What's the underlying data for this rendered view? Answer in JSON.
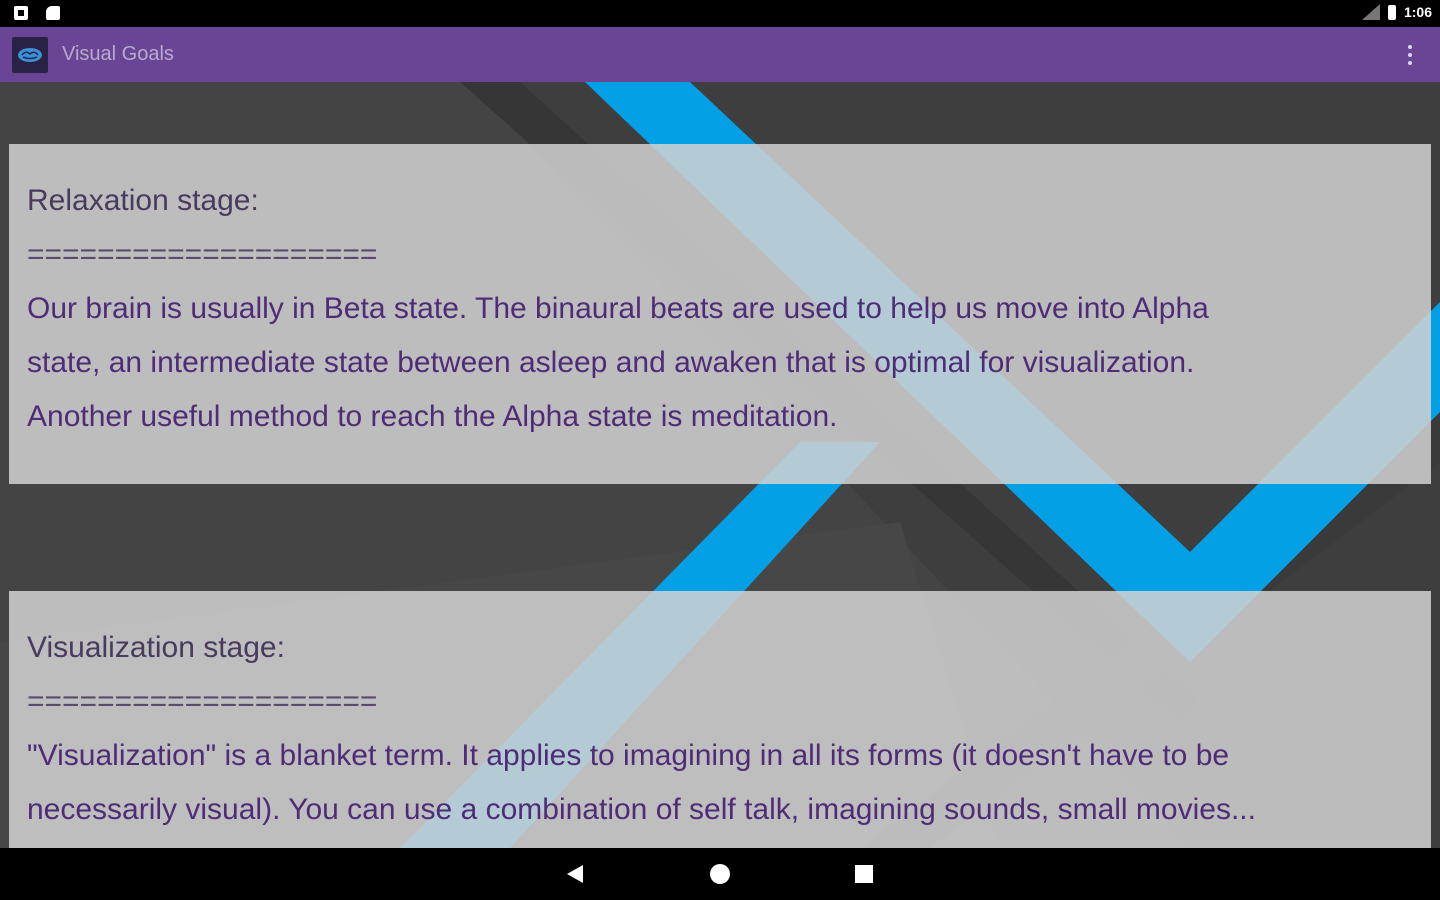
{
  "status_bar": {
    "time": "1:06",
    "network": "LTE"
  },
  "app_bar": {
    "title": "Visual Goals",
    "logo_icon": "brain-icon",
    "menu_icon": "overflow-menu-icon"
  },
  "colors": {
    "app_bar": "#6a4596",
    "background": "#444444",
    "accent_blue": "#03a0e6",
    "card_text": "#4e2c78"
  },
  "cards": [
    {
      "heading": "Relaxation stage:",
      "divider": "====================",
      "body_lines": [
        "Our brain is usually in Beta state. The binaural beats are used to help us move into Alpha",
        "state, an intermediate state between asleep and awaken that is optimal for visualization.",
        "Another useful method to reach the Alpha state is meditation."
      ]
    },
    {
      "heading": "Visualization stage:",
      "divider": "====================",
      "body_lines": [
        "\"Visualization\" is a blanket term. It applies to imagining in all its forms (it doesn't have to be",
        "necessarily visual). You can use a combination of self talk, imagining sounds, small movies..."
      ]
    }
  ],
  "nav_bar": {
    "back_icon": "back-triangle-icon",
    "home_icon": "home-circle-icon",
    "recents_icon": "recents-square-icon"
  }
}
